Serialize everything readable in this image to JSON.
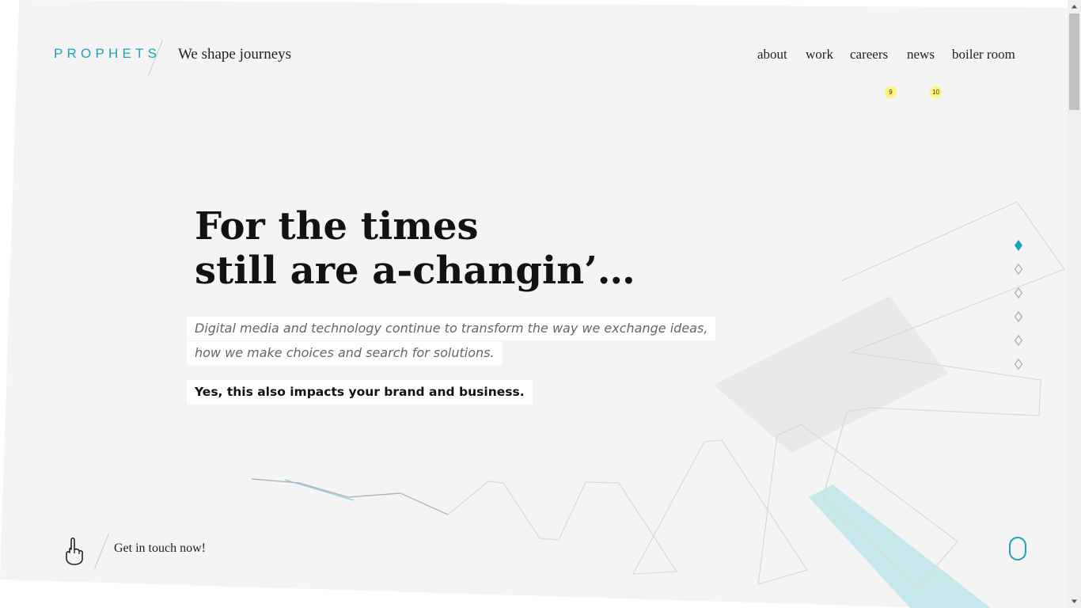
{
  "brand": {
    "logo_text": "PROPHETS",
    "tagline": "We shape journeys"
  },
  "nav": {
    "items": [
      {
        "label": "about"
      },
      {
        "label": "work"
      },
      {
        "label": "careers",
        "badge": "9"
      },
      {
        "label": "news",
        "badge": "10"
      },
      {
        "label": "boiler room"
      }
    ]
  },
  "hero": {
    "title_line1": "For the times",
    "title_line2": "still are a-changin’…",
    "intro_line1": "Digital media and technology continue to transform the way we exchange ideas,",
    "intro_line2": "how we make choices and search for solutions.",
    "impact": "Yes, this also impacts your brand and business."
  },
  "slides": {
    "count": 6,
    "active_index": 0
  },
  "cta": {
    "label": "Get in touch now!",
    "icon": "pointing-hand-icon"
  },
  "scroll_hint": {
    "icon": "mouse-scroll-icon"
  },
  "colors": {
    "accent": "#1aa3b9",
    "background": "#f4f4f4",
    "badge": "#fff27a",
    "teal_shape": "#c7e8ea"
  }
}
